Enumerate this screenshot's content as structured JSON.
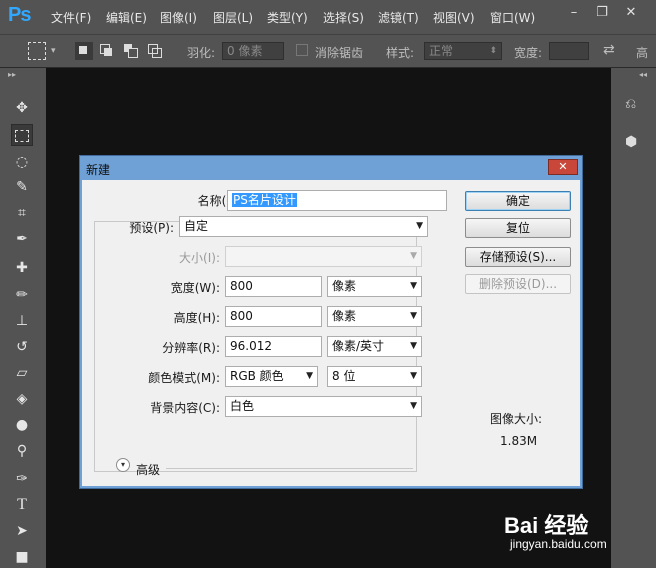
{
  "app": {
    "logo": "Ps"
  },
  "menu": {
    "items": [
      "文件(F)",
      "编辑(E)",
      "图像(I)",
      "图层(L)",
      "类型(Y)",
      "选择(S)",
      "滤镜(T)",
      "视图(V)",
      "窗口(W)"
    ],
    "window_controls": {
      "minimize": "–",
      "restore": "❐",
      "close": "✕"
    }
  },
  "options": {
    "feather_label": "羽化:",
    "feather_value": "0 像素",
    "antialias_label": "消除锯齿",
    "style_label": "样式:",
    "style_value": "正常",
    "width_label": "宽度:",
    "height_label": "高"
  },
  "dialog": {
    "title": "新建",
    "close_label": "✕",
    "name_label": "名称(N):",
    "name_value": "PS名片设计",
    "preset_label": "预设(P):",
    "preset_value": "自定",
    "size_label": "大小(I):",
    "size_value": "",
    "width_label": "宽度(W):",
    "width_value": "800",
    "width_unit": "像素",
    "height_label": "高度(H):",
    "height_value": "800",
    "height_unit": "像素",
    "resolution_label": "分辨率(R):",
    "resolution_value": "96.012",
    "resolution_unit": "像素/英寸",
    "color_mode_label": "颜色模式(M):",
    "color_mode_value": "RGB 颜色",
    "bit_depth_value": "8 位",
    "background_label": "背景内容(C):",
    "background_value": "白色",
    "advanced_label": "高级",
    "buttons": {
      "ok": "确定",
      "reset": "复位",
      "save_preset": "存储预设(S)...",
      "delete_preset": "删除预设(D)..."
    },
    "image_size_label": "图像大小:",
    "image_size_value": "1.83M"
  },
  "watermark": {
    "brand": "Bai 经验",
    "url": "jingyan.baidu.com"
  },
  "colors": {
    "accent": "#31a8ff",
    "dialog_frame": "#6fa0d6",
    "selection": "#3399ff"
  }
}
